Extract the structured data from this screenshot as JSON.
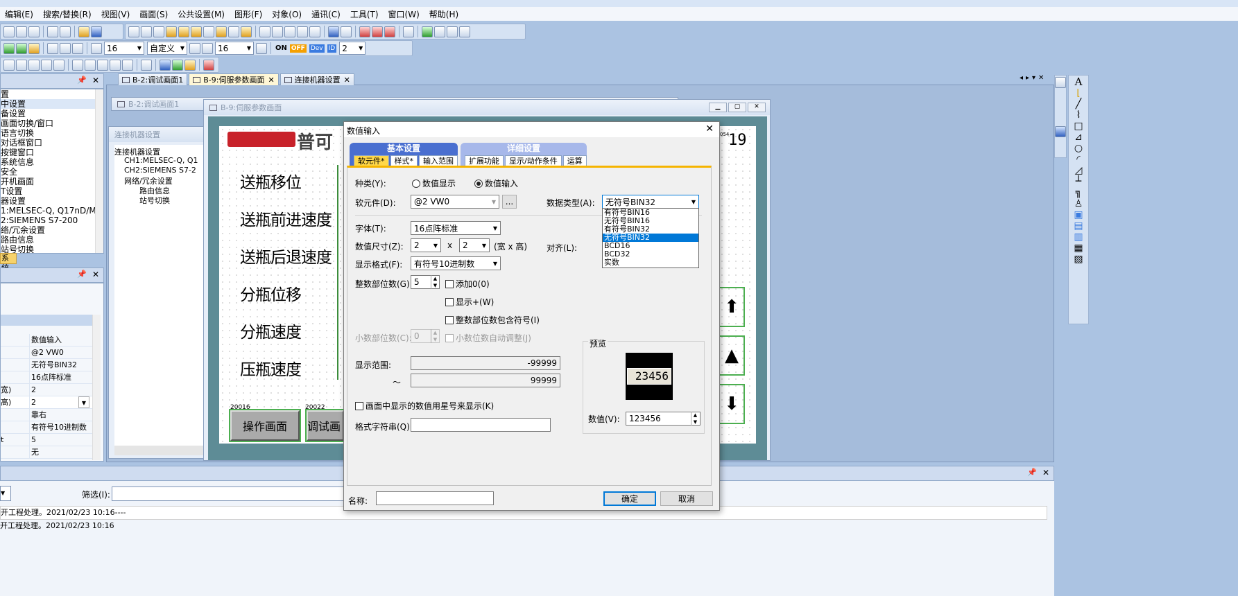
{
  "menu": [
    "编辑(E)",
    "搜索/替换(R)",
    "视图(V)",
    "画面(S)",
    "公共设置(M)",
    "图形(F)",
    "对象(O)",
    "通讯(C)",
    "工具(T)",
    "窗口(W)",
    "帮助(H)"
  ],
  "toolbar2": {
    "font_size": "16",
    "style": "自定义",
    "text_size": "16",
    "on": "ON",
    "off": "OFF",
    "dev": "Dev",
    "id": "ID",
    "count": "2"
  },
  "left_tree": [
    "置",
    "中设置",
    "备设置",
    "画面切换/窗口",
    "语言切换",
    "对话框窗口",
    "按键窗口",
    "系统信息",
    "安全",
    "开机画面",
    "T设置",
    "器设置",
    "1:MELSEC-Q, Q17nD/M",
    "2:SIEMENS S7-200",
    "络/冗余设置",
    "路由信息",
    "站号切换"
  ],
  "left_tab": "系统",
  "props": [
    {
      "k": "",
      "v": "数值输入"
    },
    {
      "k": "",
      "v": "@2 VW0"
    },
    {
      "k": "",
      "v": "无符号BIN32"
    },
    {
      "k": "",
      "v": "16点阵标准"
    },
    {
      "k": "宽)",
      "v": "2"
    },
    {
      "k": "高)",
      "v": "2"
    },
    {
      "k": "",
      "v": "靠右"
    },
    {
      "k": "",
      "v": "有符号10进制数"
    },
    {
      "k": "t",
      "v": "5"
    },
    {
      "k": "",
      "v": "无"
    }
  ],
  "tabs": [
    "B-2:调试画面1",
    "B-9:伺服参数画面",
    "连接机器设置"
  ],
  "win_b2": "B-2:调试画面1",
  "win_conn": "连接机器设置",
  "conn_tree": [
    "连接机器设置",
    "CH1:MELSEC-Q, Q1",
    "CH2:SIEMENS S7-2",
    "网络/冗余设置",
    "路由信息",
    "站号切换"
  ],
  "win_b9": "B-9:伺服参数画面",
  "screen": {
    "logo": "普可",
    "labels": [
      "送瓶移位",
      "送瓶前进速度",
      "送瓶后退速度",
      "分瓶位移",
      "分瓶速度",
      "压瓶速度"
    ],
    "btn1_no": "20016",
    "btn1": "操作画面",
    "btn2_no": "20022",
    "btn2": "调试画",
    "clock": "19",
    "clock_small": "054"
  },
  "output": {
    "filter_label": "筛选(I):",
    "lines": [
      "开工程处理。2021/02/23 10:16----",
      "开工程处理。2021/02/23 10:16"
    ]
  },
  "dialog": {
    "title": "数值输入",
    "group1": "基本设置",
    "group2": "详细设置",
    "tabs1": [
      "软元件*",
      "样式*",
      "输入范围"
    ],
    "tabs2": [
      "扩展功能",
      "显示/动作条件",
      "运算"
    ],
    "kind_label": "种类(Y):",
    "kind_display": "数值显示",
    "kind_input": "数值输入",
    "device_label": "软元件(D):",
    "device_value": "@2 VW0",
    "browse": "...",
    "dtype_label": "数据类型(A):",
    "dtype_value": "无符号BIN32",
    "dtype_options": [
      "有符号BIN16",
      "无符号BIN16",
      "有符号BIN32",
      "无符号BIN32",
      "BCD16",
      "BCD32",
      "实数"
    ],
    "font_label": "字体(T):",
    "font_value": "16点阵标准",
    "size_label": "数值尺寸(Z):",
    "size_w": "2",
    "size_x": "x",
    "size_h": "2",
    "size_unit": "(宽 x 高)",
    "align_label": "对齐(L):",
    "format_label": "显示格式(F):",
    "format_value": "有符号10进制数",
    "int_label": "整数部位数(G):",
    "int_value": "5",
    "add0": "添加0(0)",
    "showplus": "显示+(W)",
    "incsign": "整数部位数包含符号(I)",
    "dec_label": "小数部位数(C):",
    "dec_value": "0",
    "decauto": "小数位数自动调整(J)",
    "range_label": "显示范围:",
    "range_min": "-99999",
    "tilde": "～",
    "range_max": "99999",
    "asterisk": "画面中显示的数值用星号来显示(K)",
    "fmtstr_label": "格式字符串(Q):",
    "preview_label": "预览",
    "preview_value": "23456",
    "value_label": "数值(V):",
    "value_value": "123456",
    "name_label": "名称:",
    "ok": "确定",
    "cancel": "取消"
  }
}
